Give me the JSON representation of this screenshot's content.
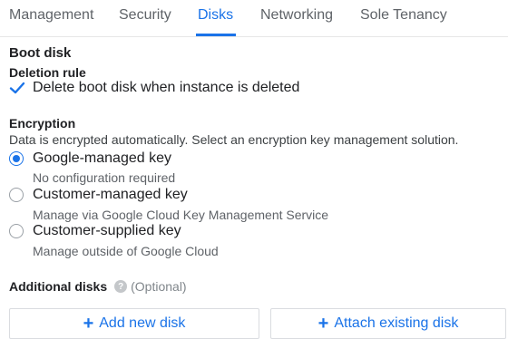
{
  "tabs": [
    {
      "label": "Management"
    },
    {
      "label": "Security"
    },
    {
      "label": "Disks"
    },
    {
      "label": "Networking"
    },
    {
      "label": "Sole Tenancy"
    }
  ],
  "active_tab": "Disks",
  "boot_disk": {
    "title": "Boot disk",
    "deletion_rule_label": "Deletion rule",
    "delete_checkbox_label": "Delete boot disk when instance is deleted",
    "delete_checked": true
  },
  "encryption": {
    "title": "Encryption",
    "description": "Data is encrypted automatically. Select an encryption key management solution.",
    "options": [
      {
        "label": "Google-managed key",
        "description": "No configuration required",
        "selected": true
      },
      {
        "label": "Customer-managed key",
        "description": "Manage via Google Cloud Key Management Service",
        "selected": false
      },
      {
        "label": "Customer-supplied key",
        "description": "Manage outside of Google Cloud",
        "selected": false
      }
    ]
  },
  "additional_disks": {
    "title": "Additional disks",
    "optional_text": "(Optional)",
    "add_new_label": "Add new disk",
    "attach_existing_label": "Attach existing disk"
  },
  "colors": {
    "accent": "#1a73e8",
    "text": "#202124",
    "muted": "#5f6368"
  }
}
